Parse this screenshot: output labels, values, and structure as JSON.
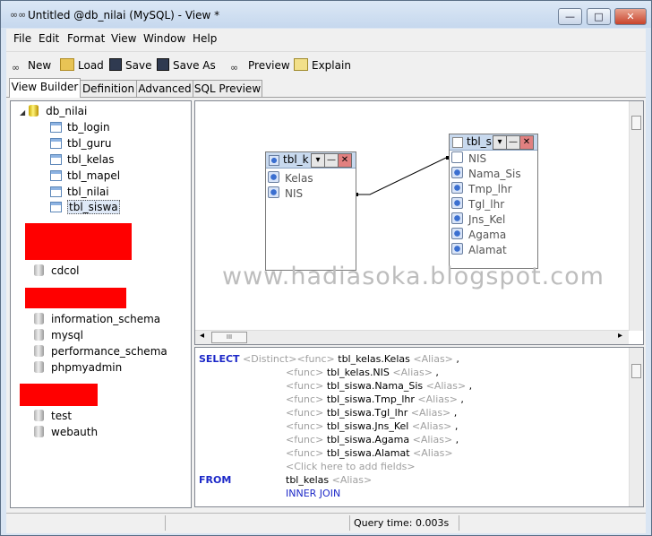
{
  "window": {
    "title": "Untitled @db_nilai (MySQL) - View *",
    "min": "—",
    "max": "□",
    "close": "✕"
  },
  "menu": [
    "File",
    "Edit",
    "Format",
    "View",
    "Window",
    "Help"
  ],
  "toolbar": {
    "new": "New",
    "load": "Load",
    "save": "Save",
    "save_as": "Save As",
    "preview": "Preview",
    "explain": "Explain"
  },
  "tabs": [
    "View Builder",
    "Definition",
    "Advanced",
    "SQL Preview"
  ],
  "tree": {
    "database": "db_nilai",
    "tables": [
      "tb_login",
      "tbl_guru",
      "tbl_kelas",
      "tbl_mapel",
      "tbl_nilai",
      "tbl_siswa"
    ],
    "selected_table": "tbl_siswa",
    "other_databases": [
      "cdcol",
      "information_schema",
      "mysql",
      "performance_schema",
      "phpmyadmin",
      "test",
      "webauth"
    ],
    "collapse_glyph": "◢"
  },
  "diagram": {
    "watermark": "www.hadiasoka.blogspot.com",
    "table1": {
      "title": "tbl_k",
      "fields": [
        "Kelas",
        "NIS"
      ]
    },
    "table2": {
      "title": "tbl_s",
      "fields": [
        "NIS",
        "Nama_Sis",
        "Tmp_lhr",
        "Tgl_lhr",
        "Jns_Kel",
        "Agama",
        "Alamat"
      ]
    },
    "hscroll_left": "◂",
    "hscroll_right": "▸",
    "hscroll_thumb": "III"
  },
  "sql": {
    "select": "SELECT",
    "distinct": "<Distinct>",
    "func": "<func>",
    "alias": "<Alias>",
    "fields": [
      "tbl_kelas.Kelas",
      "tbl_kelas.NIS",
      "tbl_siswa.Nama_Sis",
      "tbl_siswa.Tmp_lhr",
      "tbl_siswa.Tgl_lhr",
      "tbl_siswa.Jns_Kel",
      "tbl_siswa.Agama",
      "tbl_siswa.Alamat"
    ],
    "add_fields": "<Click here to add fields>",
    "from": "FROM",
    "from_table": "tbl_kelas",
    "join": "INNER JOIN"
  },
  "status": {
    "query_time": "Query time: 0.003s"
  },
  "colors": {
    "keyword": "#1c28c8",
    "placeholder": "#a0a0a0",
    "redaction": "#ff0000"
  }
}
